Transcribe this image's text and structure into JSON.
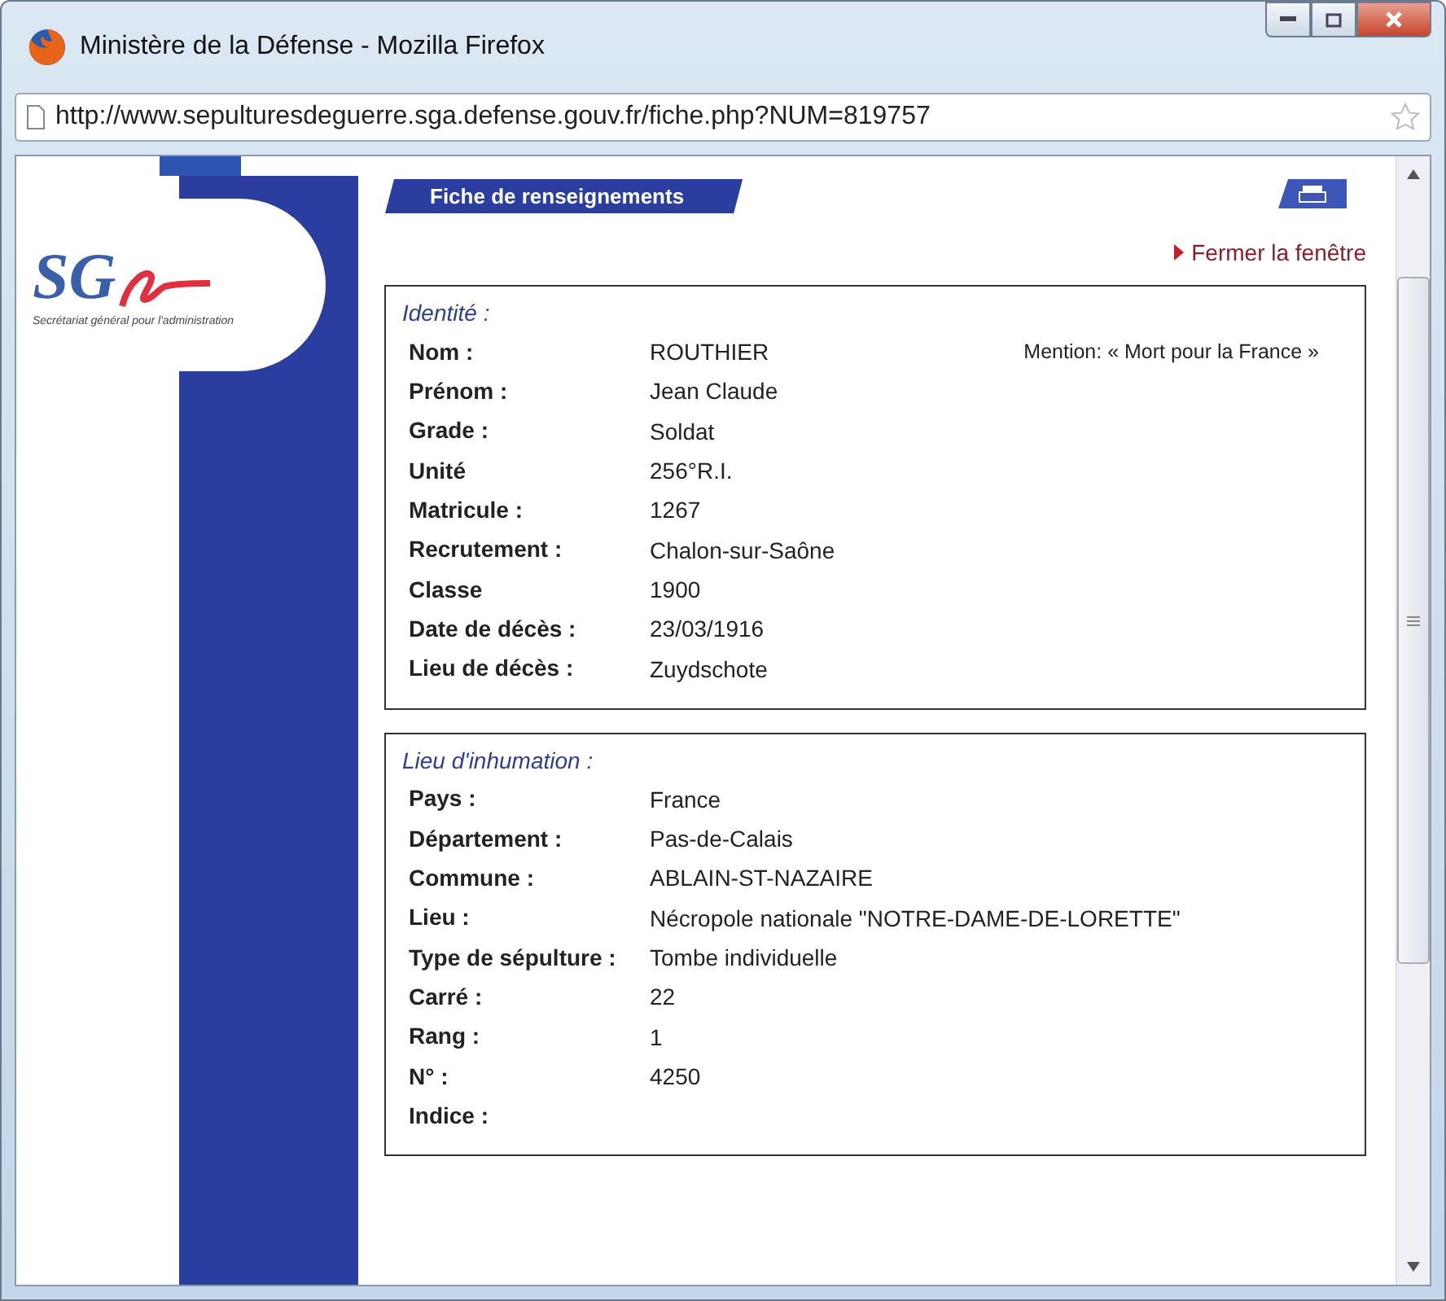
{
  "window": {
    "title": "Ministère de la Défense - Mozilla Firefox"
  },
  "address_bar": {
    "url": "http://www.sepulturesdeguerre.sga.defense.gouv.fr/fiche.php?NUM=819757"
  },
  "logo": {
    "letters": "SG",
    "tagline": "Secrétariat général pour l'administration"
  },
  "page_tab": {
    "label": "Fiche de renseignements"
  },
  "close_link": {
    "label": "Fermer la fenêtre"
  },
  "sections": [
    {
      "title": "Identité :",
      "mention": "Mention: « Mort pour la France »",
      "rows": [
        {
          "label": "Nom :",
          "value": "ROUTHIER"
        },
        {
          "label": "Prénom :",
          "value": "Jean Claude"
        },
        {
          "label": "Grade :",
          "value": "Soldat"
        },
        {
          "label": "Unité",
          "value": "256°R.I."
        },
        {
          "label": "Matricule :",
          "value": "1267"
        },
        {
          "label": "Recrutement :",
          "value": "Chalon-sur-Saône"
        },
        {
          "label": "Classe",
          "value": "1900"
        },
        {
          "label": "Date de décès :",
          "value": "23/03/1916"
        },
        {
          "label": "Lieu de décès :",
          "value": "Zuydschote"
        }
      ]
    },
    {
      "title": "Lieu d'inhumation :",
      "rows": [
        {
          "label": "Pays :",
          "value": "France"
        },
        {
          "label": "Département :",
          "value": "Pas-de-Calais"
        },
        {
          "label": "Commune :",
          "value": "ABLAIN-ST-NAZAIRE"
        },
        {
          "label": "Lieu :",
          "value": "Nécropole nationale \"NOTRE-DAME-DE-LORETTE\""
        },
        {
          "label": "Type de sépulture :",
          "value": "Tombe individuelle"
        },
        {
          "label": "Carré :",
          "value": "22"
        },
        {
          "label": "Rang :",
          "value": "1"
        },
        {
          "label": "N° :",
          "value": "4250"
        },
        {
          "label": "Indice :",
          "value": ""
        }
      ]
    }
  ]
}
